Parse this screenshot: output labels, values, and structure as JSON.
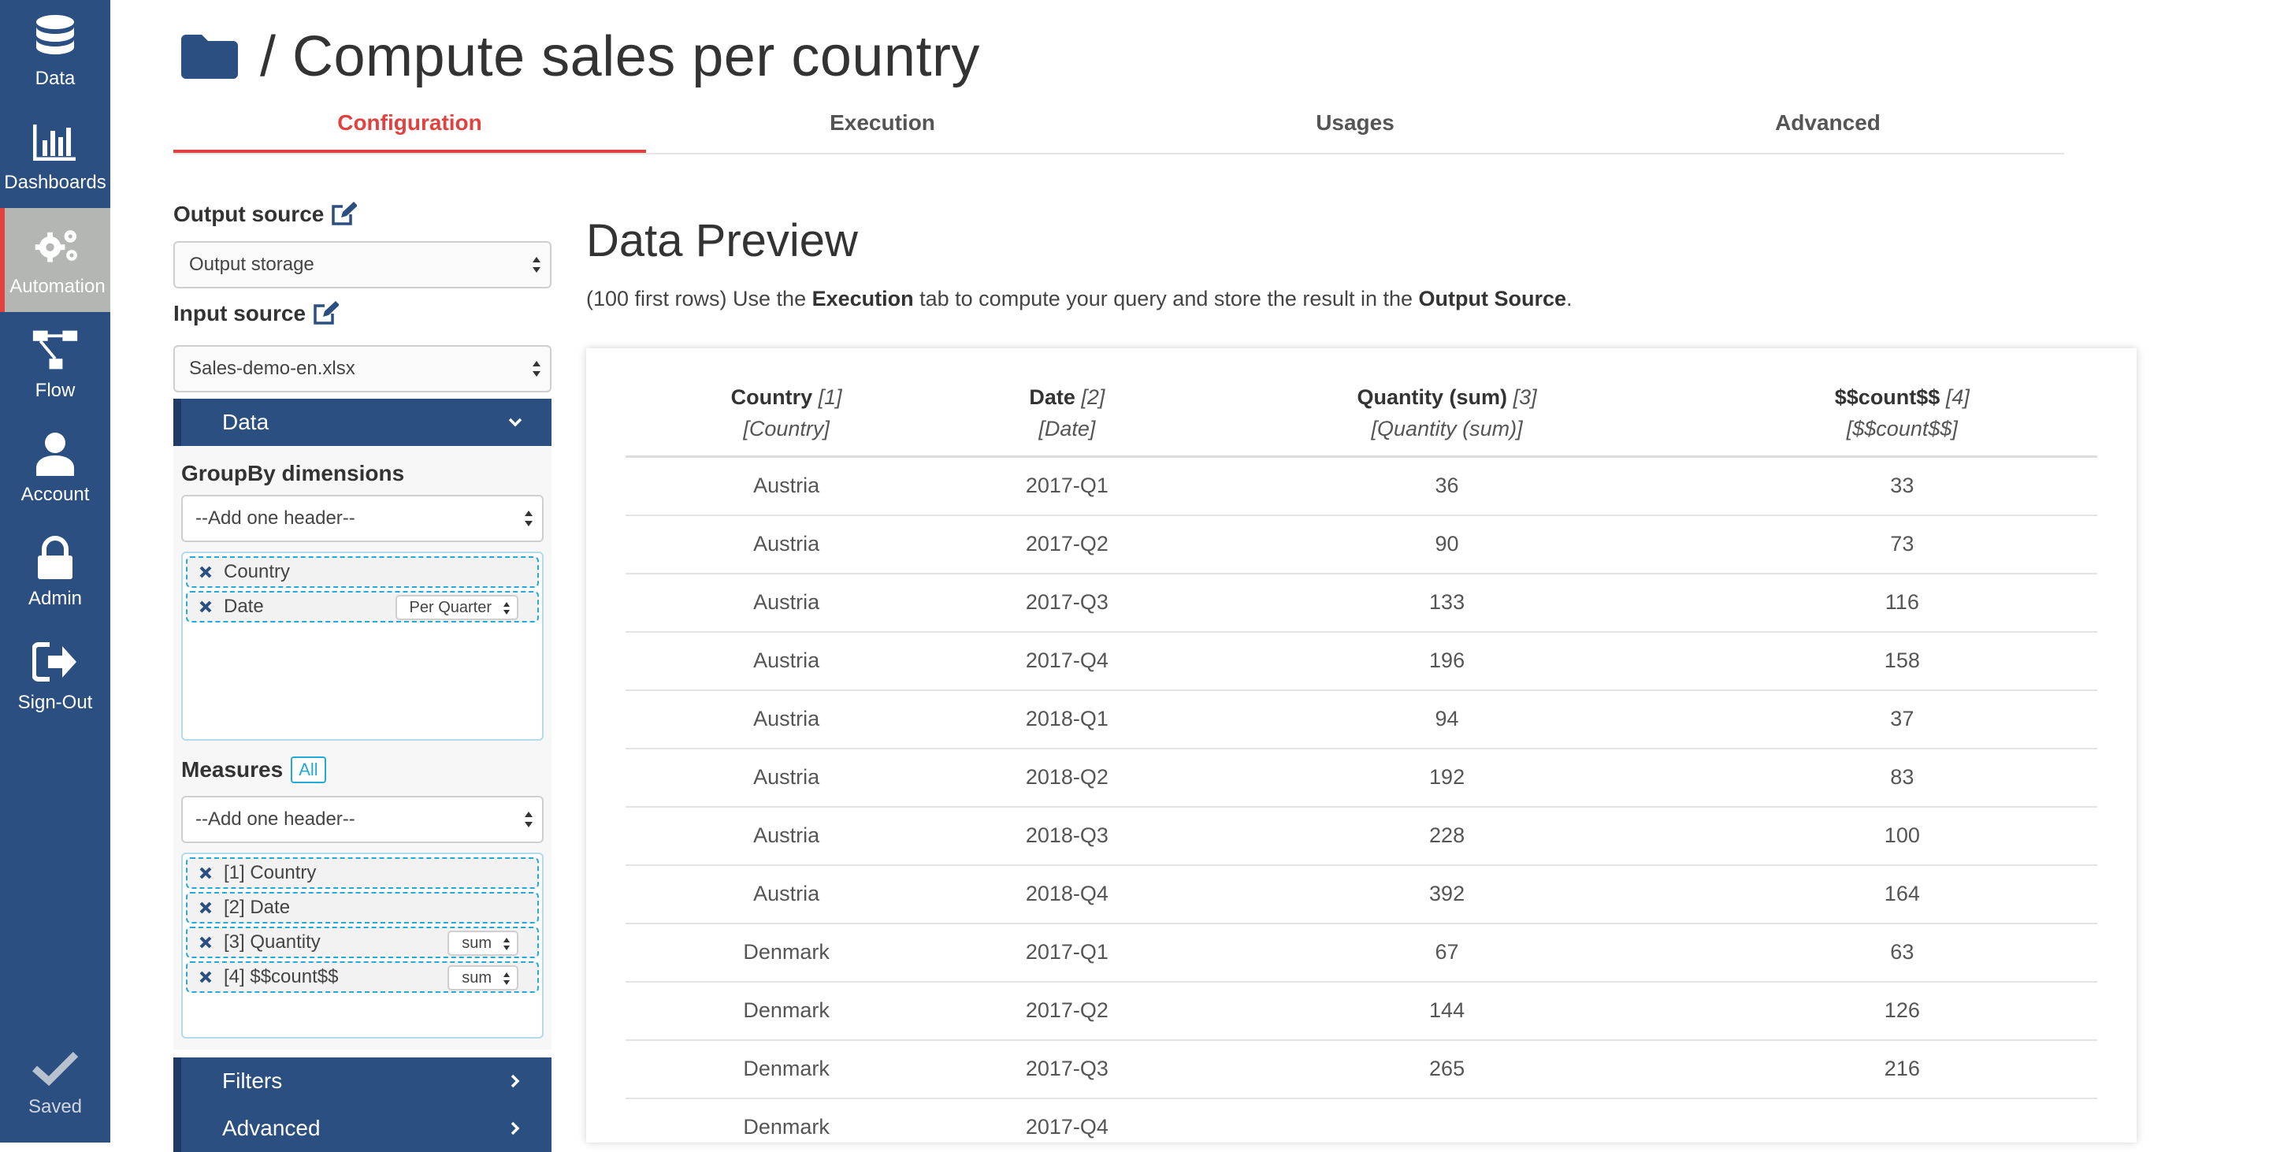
{
  "nav": {
    "items": [
      {
        "label": "Data",
        "icon": "database-icon"
      },
      {
        "label": "Dashboards",
        "icon": "bar-chart-icon"
      },
      {
        "label": "Automation",
        "icon": "gears-icon"
      },
      {
        "label": "Flow",
        "icon": "flow-icon"
      },
      {
        "label": "Account",
        "icon": "user-icon"
      },
      {
        "label": "Admin",
        "icon": "lock-icon"
      },
      {
        "label": "Sign-Out",
        "icon": "sign-out-icon"
      }
    ],
    "active": "Automation",
    "saved_label": "Saved"
  },
  "header": {
    "title": "/ Compute sales per country"
  },
  "tabs": [
    {
      "label": "Configuration",
      "active": true
    },
    {
      "label": "Execution",
      "active": false
    },
    {
      "label": "Usages",
      "active": false
    },
    {
      "label": "Advanced",
      "active": false
    }
  ],
  "config": {
    "output_source_label": "Output source",
    "output_source_value": "Output storage",
    "input_source_label": "Input source",
    "input_source_value": "Sales-demo-en.xlsx",
    "data_section": "Data",
    "groupby_label": "GroupBy dimensions",
    "groupby_placeholder": "--Add one header--",
    "groupby_items": [
      {
        "label": "Country",
        "option": ""
      },
      {
        "label": "Date",
        "option": "Per Quarter"
      }
    ],
    "measures_label": "Measures",
    "measures_all": "All",
    "measures_placeholder": "--Add one header--",
    "measure_items": [
      {
        "label": "[1] Country",
        "option": ""
      },
      {
        "label": "[2] Date",
        "option": ""
      },
      {
        "label": "[3] Quantity",
        "option": "sum"
      },
      {
        "label": "[4] $$count$$",
        "option": "sum"
      }
    ],
    "filters_section": "Filters",
    "advanced_section": "Advanced"
  },
  "preview": {
    "title": "Data Preview",
    "desc_prefix": "(100 first rows) Use the ",
    "desc_bold1": "Execution",
    "desc_mid": " tab to compute your query and store the result in the ",
    "desc_bold2": "Output Source",
    "desc_suffix": ".",
    "columns": [
      {
        "name": "Country",
        "index": "[1]",
        "sub": "[Country]"
      },
      {
        "name": "Date",
        "index": "[2]",
        "sub": "[Date]"
      },
      {
        "name": "Quantity (sum)",
        "index": "[3]",
        "sub": "[Quantity (sum)]"
      },
      {
        "name": "$$count$$",
        "index": "[4]",
        "sub": "[$$count$$]"
      }
    ],
    "rows": [
      [
        "Austria",
        "2017-Q1",
        "36",
        "33"
      ],
      [
        "Austria",
        "2017-Q2",
        "90",
        "73"
      ],
      [
        "Austria",
        "2017-Q3",
        "133",
        "116"
      ],
      [
        "Austria",
        "2017-Q4",
        "196",
        "158"
      ],
      [
        "Austria",
        "2018-Q1",
        "94",
        "37"
      ],
      [
        "Austria",
        "2018-Q2",
        "192",
        "83"
      ],
      [
        "Austria",
        "2018-Q3",
        "228",
        "100"
      ],
      [
        "Austria",
        "2018-Q4",
        "392",
        "164"
      ],
      [
        "Denmark",
        "2017-Q1",
        "67",
        "63"
      ],
      [
        "Denmark",
        "2017-Q2",
        "144",
        "126"
      ],
      [
        "Denmark",
        "2017-Q3",
        "265",
        "216"
      ],
      [
        "Denmark",
        "2017-Q4",
        "",
        ""
      ]
    ]
  },
  "colors": {
    "nav_bg": "#2b4f80",
    "accent_red": "#e0433f",
    "chip_border": "#27a9d6"
  }
}
